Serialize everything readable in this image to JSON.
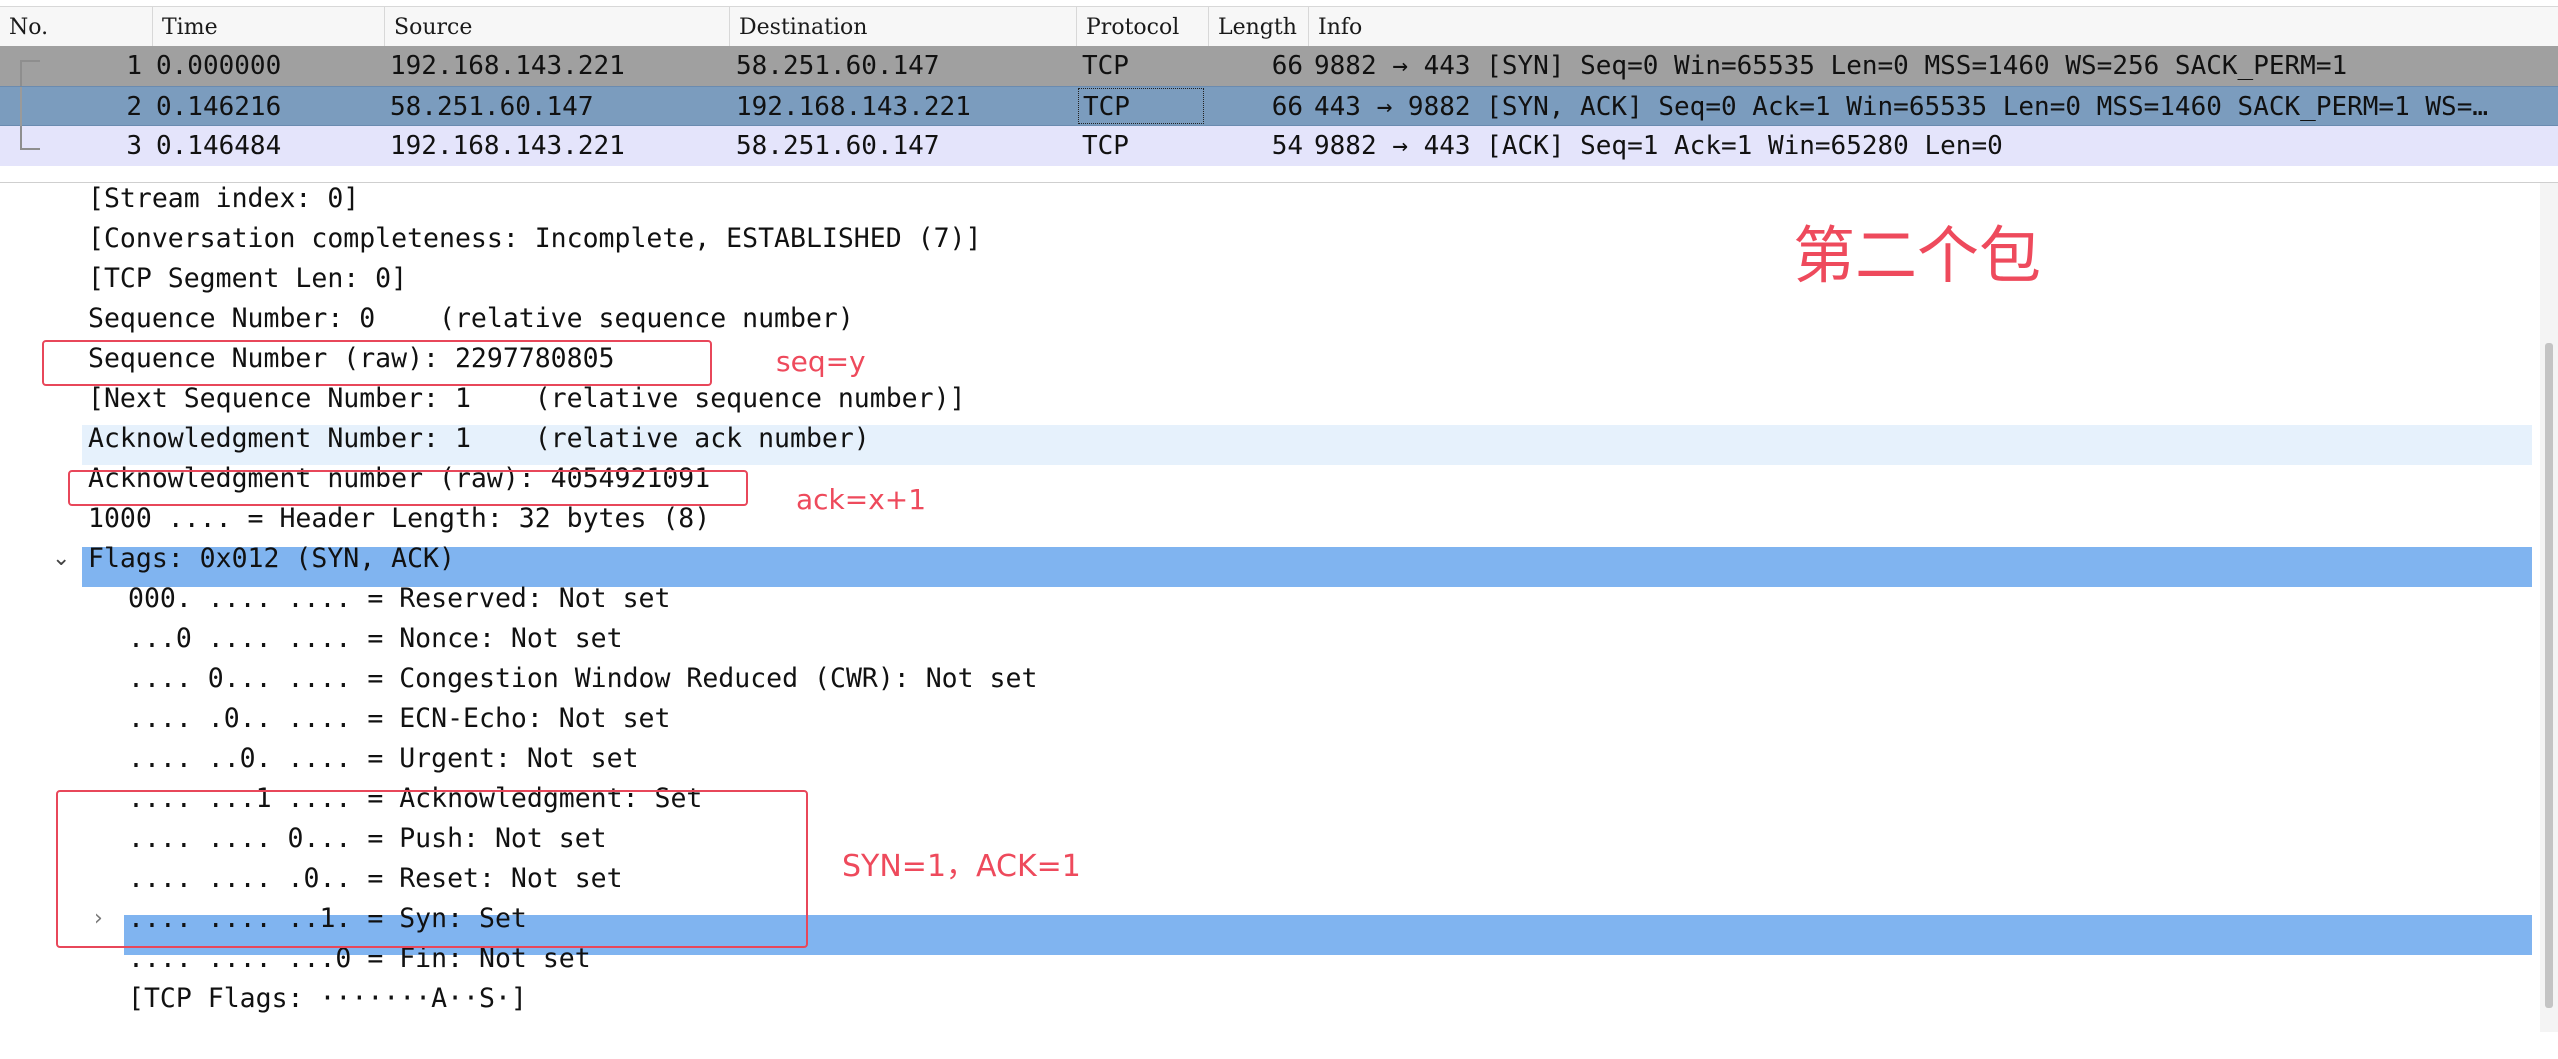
{
  "packet_list": {
    "columns": [
      "No.",
      "Time",
      "Source",
      "Destination",
      "Protocol",
      "Length",
      "Info"
    ],
    "rows": [
      {
        "no": "1",
        "time": "0.000000",
        "source": "192.168.143.221",
        "destination": "58.251.60.147",
        "protocol": "TCP",
        "length": "66",
        "info": "9882 → 443 [SYN] Seq=0 Win=65535 Len=0 MSS=1460 WS=256 SACK_PERM=1"
      },
      {
        "no": "2",
        "time": "0.146216",
        "source": "58.251.60.147",
        "destination": "192.168.143.221",
        "protocol": "TCP",
        "length": "66",
        "info": "443 → 9882 [SYN, ACK] Seq=0 Ack=1 Win=65535 Len=0 MSS=1460 SACK_PERM=1 WS=…"
      },
      {
        "no": "3",
        "time": "0.146484",
        "source": "192.168.143.221",
        "destination": "58.251.60.147",
        "protocol": "TCP",
        "length": "54",
        "info": "9882 → 443 [ACK] Seq=1 Ack=1 Win=65280 Len=0"
      }
    ],
    "selected_row": 2
  },
  "details": {
    "lines": [
      "[Stream index: 0]",
      "[Conversation completeness: Incomplete, ESTABLISHED (7)]",
      "[TCP Segment Len: 0]",
      "Sequence Number: 0    (relative sequence number)",
      "Sequence Number (raw): 2297780805",
      "[Next Sequence Number: 1    (relative sequence number)]",
      "Acknowledgment Number: 1    (relative ack number)",
      "Acknowledgment number (raw): 4054921091",
      "1000 .... = Header Length: 32 bytes (8)",
      "Flags: 0x012 (SYN, ACK)",
      "000. .... .... = Reserved: Not set",
      "...0 .... .... = Nonce: Not set",
      ".... 0... .... = Congestion Window Reduced (CWR): Not set",
      ".... .0.. .... = ECN-Echo: Not set",
      ".... ..0. .... = Urgent: Not set",
      ".... ...1 .... = Acknowledgment: Set",
      ".... .... 0... = Push: Not set",
      ".... .... .0.. = Reset: Not set",
      ".... .... ..1. = Syn: Set",
      ".... .... ...0 = Fin: Not set",
      "[TCP Flags: ·······A··S·]"
    ],
    "expanded_marker": "⌄",
    "collapsed_marker": "›"
  },
  "annotations": {
    "title": "第二个包",
    "seq": "seq=y",
    "ack": "ack=x+1",
    "flags": "SYN=1，ACK=1",
    "color": "#ee4a5c"
  },
  "colors": {
    "selected_row": "#7b9cbe",
    "row1": "#a0a0a0",
    "row3": "#e4e4fb",
    "highlight_blue": "#80b4f0",
    "highlight_light": "#e6f1fc"
  }
}
